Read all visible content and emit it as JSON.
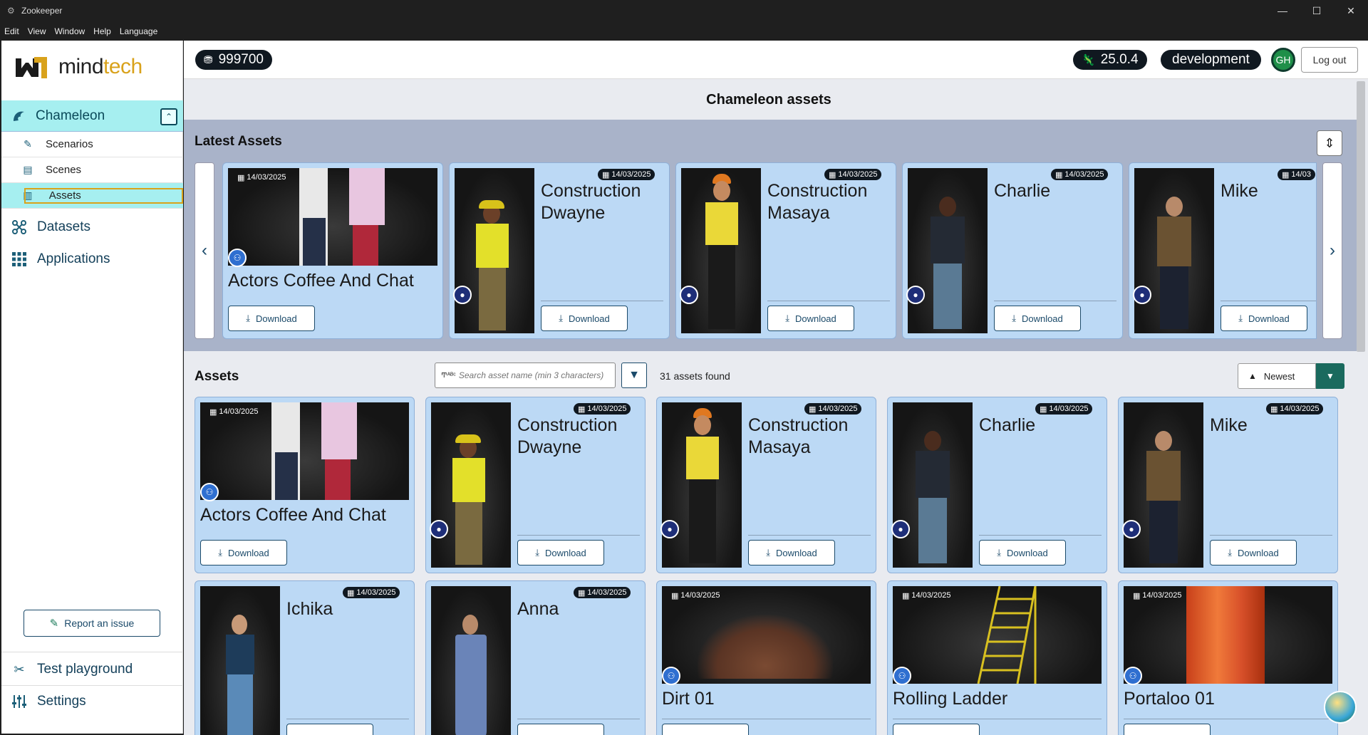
{
  "window": {
    "title": "Zookeeper",
    "controls": [
      "—",
      "☐",
      "✕"
    ]
  },
  "menu": [
    "Edit",
    "View",
    "Window",
    "Help",
    "Language"
  ],
  "sidebar": {
    "logo_a": "mind",
    "logo_b": "tech",
    "top_item": "Chameleon",
    "sub_items": [
      "Scenarios",
      "Scenes",
      "Assets"
    ],
    "items": [
      "Datasets",
      "Applications"
    ],
    "report": "Report an issue",
    "bottom_items": [
      "Test playground",
      "Settings"
    ]
  },
  "topbar": {
    "credits": "999700",
    "version": "25.0.4",
    "environment": "development",
    "avatar": "GH",
    "logout": "Log out"
  },
  "page_title": "Chameleon assets",
  "latest": {
    "label": "Latest Assets",
    "cards": [
      {
        "name": "Actors Coffee And Chat",
        "date": "14/03/2025",
        "kind": "scene",
        "download": "Download"
      },
      {
        "name": "Construction Dwayne",
        "date": "14/03/2025",
        "kind": "person",
        "download": "Download"
      },
      {
        "name": "Construction Masaya",
        "date": "14/03/2025",
        "kind": "person",
        "download": "Download"
      },
      {
        "name": "Charlie",
        "date": "14/03/2025",
        "kind": "person",
        "download": "Download"
      },
      {
        "name": "Mike",
        "date": "14/03",
        "kind": "person",
        "download": "Download"
      }
    ]
  },
  "assets": {
    "label": "Assets",
    "search_placeholder": "Search asset name (min 3 characters)",
    "count": "31 assets found",
    "sort": "Newest",
    "row1": [
      {
        "name": "Actors Coffee And Chat",
        "date": "14/03/2025",
        "kind": "scene",
        "download": "Download"
      },
      {
        "name": "Construction Dwayne",
        "date": "14/03/2025",
        "kind": "person",
        "download": "Download"
      },
      {
        "name": "Construction Masaya",
        "date": "14/03/2025",
        "kind": "person",
        "download": "Download"
      },
      {
        "name": "Charlie",
        "date": "14/03/2025",
        "kind": "person",
        "download": "Download"
      },
      {
        "name": "Mike",
        "date": "14/03/2025",
        "kind": "person",
        "download": "Download"
      }
    ],
    "row2": [
      {
        "name": "Ichika",
        "date": "14/03/2025",
        "kind": "person"
      },
      {
        "name": "Anna",
        "date": "14/03/2025",
        "kind": "person"
      },
      {
        "name": "Dirt 01",
        "date": "14/03/2025",
        "kind": "object"
      },
      {
        "name": "Rolling Ladder",
        "date": "14/03/2025",
        "kind": "object"
      },
      {
        "name": "Portaloo 01",
        "date": "14/03/2025",
        "kind": "object"
      }
    ]
  }
}
